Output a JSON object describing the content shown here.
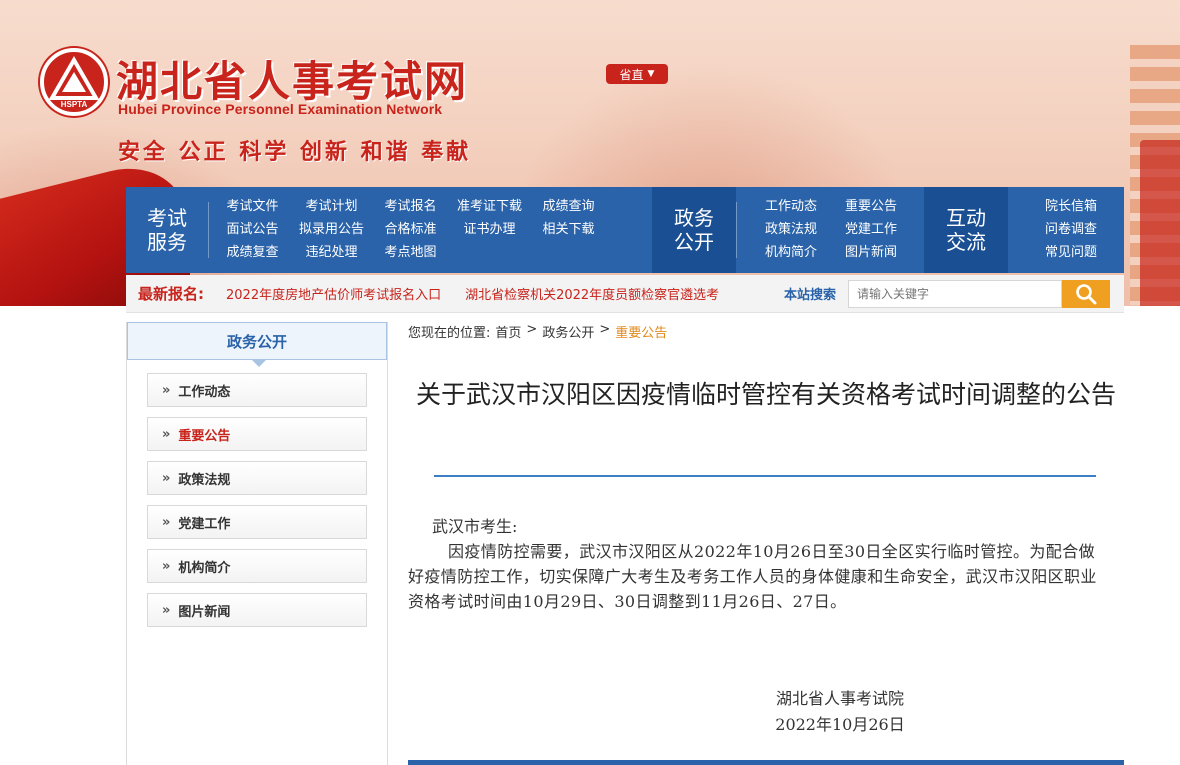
{
  "header": {
    "site_title": "湖北省人事考试网",
    "site_subtitle": "Hubei Province Personnel Examination Network",
    "logo_text": "HSPTA",
    "slogan": "安全 公正 科学 创新 和谐 奉献",
    "region_selector": "省直"
  },
  "nav": {
    "group1": {
      "title": "考试服务",
      "links": [
        "考试文件",
        "考试计划",
        "考试报名",
        "准考证下载",
        "成绩查询",
        "面试公告",
        "拟录用公告",
        "合格标准",
        "证书办理",
        "相关下载",
        "成绩复查",
        "违纪处理",
        "考点地图"
      ]
    },
    "group2": {
      "title": "政务公开",
      "links": [
        "工作动态",
        "重要公告",
        "政策法规",
        "党建工作",
        "机构简介",
        "图片新闻"
      ]
    },
    "group3": {
      "title": "互动交流",
      "links": [
        "院长信箱",
        "问卷调查",
        "常见问题"
      ]
    }
  },
  "ticker": {
    "label": "最新报名:",
    "items": [
      "2022年度房地产估价师考试报名入口",
      "湖北省检察机关2022年度员额检察官遴选考"
    ],
    "search_label": "本站搜索",
    "search_placeholder": "请输入关键字"
  },
  "sidebar": {
    "title": "政务公开",
    "items": [
      {
        "label": "工作动态",
        "active": false
      },
      {
        "label": "重要公告",
        "active": true
      },
      {
        "label": "政策法规",
        "active": false
      },
      {
        "label": "党建工作",
        "active": false
      },
      {
        "label": "机构简介",
        "active": false
      },
      {
        "label": "图片新闻",
        "active": false
      }
    ]
  },
  "breadcrumb": {
    "prefix": "您现在的位置:",
    "items": [
      "首页",
      "政务公开",
      "重要公告"
    ],
    "separator": ">"
  },
  "article": {
    "title": "关于武汉市汉阳区因疫情临时管控有关资格考试时间调整的公告",
    "greeting": "武汉市考生:",
    "body": "因疫情防控需要，武汉市汉阳区从2022年10月26日至30日全区实行临时管控。为配合做好疫情防控工作，切实保障广大考生及考务工作人员的身体健康和生命安全，武汉市汉阳区职业资格考试时间由10月29日、30日调整到11月26日、27日。",
    "signature_org": "湖北省人事考试院",
    "signature_date": "2022年10月26日"
  },
  "colors": {
    "brand_red": "#c8241c",
    "nav_blue": "#2a63a9",
    "search_orange": "#f0a020",
    "breadcrumb_current": "#e08a1e"
  },
  "icons": {
    "search": "magnifier-icon",
    "sidebar_bullet": "double-chevron-right-icon",
    "region_caret": "caret-down-icon",
    "logo": "hspta-emblem-icon"
  }
}
